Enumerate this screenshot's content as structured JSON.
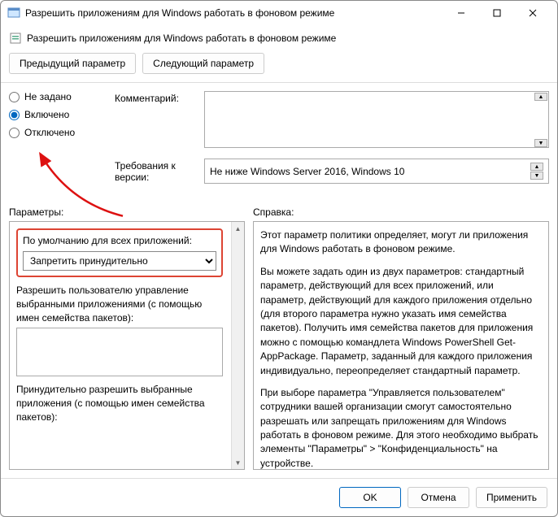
{
  "window": {
    "title": "Разрешить приложениям для Windows работать в фоновом режиме"
  },
  "header": {
    "text": "Разрешить приложениям для Windows работать в фоновом режиме"
  },
  "nav": {
    "prev": "Предыдущий параметр",
    "next": "Следующий параметр"
  },
  "radios": {
    "notset": "Не задано",
    "enabled": "Включено",
    "disabled": "Отключено"
  },
  "fields": {
    "comment_label": "Комментарий:",
    "comment_value": "",
    "version_label": "Требования к версии:",
    "version_value": "Не ниже Windows Server 2016, Windows 10"
  },
  "panels": {
    "left_label": "Параметры:",
    "right_label": "Справка:"
  },
  "options": {
    "default_label": "По умолчанию для всех приложений:",
    "default_value": "Запретить принудительно",
    "allow_user_label": "Разрешить пользователю управление выбранными приложениями (с помощью имен семейства пакетов):",
    "force_allow_label": "Принудительно разрешить выбранные приложения (с помощью имен семейства пакетов):"
  },
  "help": {
    "p1": "Этот параметр политики определяет, могут ли приложения для Windows работать в фоновом режиме.",
    "p2": "Вы можете задать один из двух параметров: стандартный параметр, действующий для всех приложений, или параметр, действующий для каждого приложения отдельно (для второго параметра нужно указать имя семейства пакетов). Получить имя семейства пакетов для приложения можно с помощью командлета Windows PowerShell Get-AppPackage. Параметр, заданный для каждого приложения индивидуально, переопределяет стандартный параметр.",
    "p3": "При выборе параметра \"Управляется пользователем\" сотрудники вашей организации смогут самостоятельно разрешать или запрещать приложениям для Windows работать в фоновом режиме. Для этого необходимо выбрать элементы \"Параметры\" > \"Конфиденциальность\" на устройстве."
  },
  "buttons": {
    "ok": "OK",
    "cancel": "Отмена",
    "apply": "Применить"
  }
}
